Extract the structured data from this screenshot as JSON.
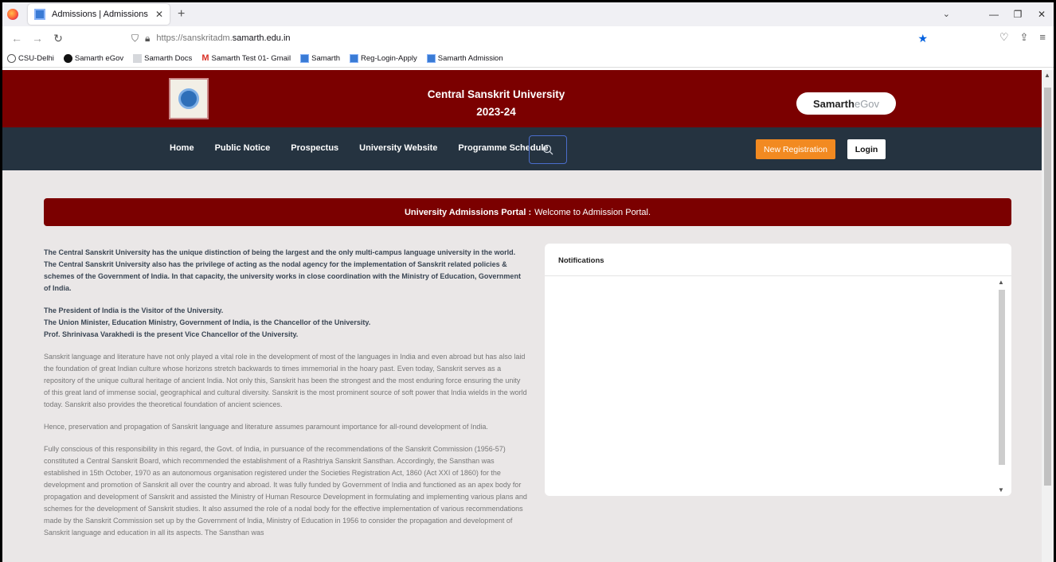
{
  "browser": {
    "tab_title": "Admissions | Admissions",
    "url_prefix": "https://sanskritadm.",
    "url_host": "samarth.edu.in",
    "bookmarks": [
      "CSU-Delhi",
      "Samarth eGov",
      "Samarth Docs",
      "Samarth Test 01- Gmail",
      "Samarth",
      "Reg-Login-Apply",
      "Samarth Admission"
    ]
  },
  "header": {
    "university_name": "Central Sanskrit University",
    "year": "2023-24",
    "egov_brand": "Samarth",
    "egov_suffix": "eGov"
  },
  "menu": {
    "items": [
      "Home",
      "Public Notice",
      "Prospectus",
      "University Website",
      "Programme Schedule"
    ],
    "new_registration": "New Registration",
    "login": "Login"
  },
  "portal": {
    "title": "University Admissions Portal :",
    "message": "Welcome to Admission Portal."
  },
  "content": {
    "intro": "The Central Sanskrit University has the unique distinction of being the largest and the only multi-campus language university in the world. The Central Sanskrit University also has the privilege of acting as the nodal agency for the implementation of Sanskrit related policies & schemes of the Government of India. In that capacity, the university works in close coordination with the Ministry of Education, Government of India.",
    "visitor": "The President of India is the Visitor of the University.",
    "chancellor": "The Union Minister, Education Ministry, Government of India, is the Chancellor of the University.",
    "vc": "Prof. Shrinivasa Varakhedi is the present Vice Chancellor of the University.",
    "para1": "Sanskrit language and literature have not only played a vital role in the development of most of the languages in India and even abroad but has also laid the foundation of great Indian culture whose horizons stretch backwards to times immemorial in the hoary past. Even today, Sanskrit serves as a repository of the unique cultural heritage of ancient India. Not only this, Sanskrit has been the strongest and the most enduring force ensuring the unity of this great land of immense social, geographical and cultural diversity. Sanskrit is the most prominent source of soft power that India wields in the world today. Sanskrit also provides the theoretical foundation of ancient sciences.",
    "para2": "Hence, preservation and propagation of Sanskrit language and literature assumes paramount importance for all-round development of India.",
    "para3": "Fully conscious of this responsibility in this regard, the Govt. of India, in pursuance of the recommendations of the Sanskrit Commission (1956-57) constituted a Central Sanskrit Board, which recommended the establishment of a Rashtriya Sanskrit Sansthan. Accordingly, the Sansthan was established in 15th October, 1970 as an autonomous organisation registered under the Societies Registration Act, 1860 (Act XXI of 1860) for the development and promotion of Sanskrit all over the country and abroad. It was fully funded by Government of India and functioned as an apex body for propagation and development of Sanskrit and assisted the Ministry of Human Resource Development in formulating and implementing various plans and schemes for the development of Sanskrit studies. It also assumed the role of a nodal body for the effective implementation of various recommendations made by the Sanskrit Commission set up by the Government of India, Ministry of Education in 1956 to consider the propagation and development of Sanskrit language and education in all its aspects. The Sansthan was"
  },
  "notifications": {
    "title": "Notifications"
  }
}
